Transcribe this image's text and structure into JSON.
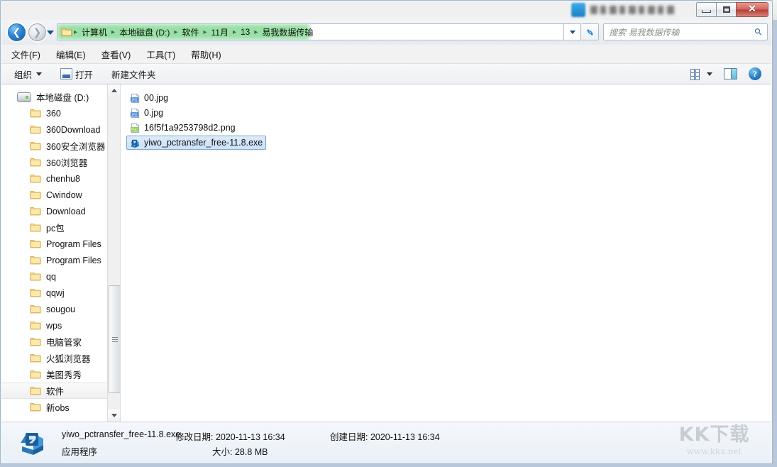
{
  "window": {
    "controls": {
      "minimize": "—",
      "maximize": "□",
      "close": "✕"
    }
  },
  "address_bar": {
    "back_label": "◀",
    "forward_label": "▶",
    "folder_icon": "folder-icon",
    "breadcrumbs": [
      "计算机",
      "本地磁盘 (D:)",
      "软件",
      "11月",
      "13",
      "易我数据传输"
    ],
    "separator": "▸",
    "dropdown_label": "▼",
    "refresh_label": "↻"
  },
  "search": {
    "placeholder": "搜索 易我数据传输",
    "icon": "search-icon"
  },
  "menu": {
    "items": [
      {
        "text": "文件(F)",
        "label": "文件",
        "key": "F"
      },
      {
        "text": "编辑(E)",
        "label": "编辑",
        "key": "E"
      },
      {
        "text": "查看(V)",
        "label": "查看",
        "key": "V"
      },
      {
        "text": "工具(T)",
        "label": "工具",
        "key": "T"
      },
      {
        "text": "帮助(H)",
        "label": "帮助",
        "key": "H"
      }
    ]
  },
  "toolbar": {
    "organize_label": "组织",
    "open_label": "打开",
    "new_folder_label": "新建文件夹",
    "view_icon": "view-options-icon",
    "view_caret": "▼",
    "preview_pane_icon": "preview-pane-icon",
    "help_icon": "help-icon",
    "help_glyph": "?"
  },
  "sidebar": {
    "root": {
      "label": "本地磁盘 (D:)",
      "icon": "drive-icon"
    },
    "items": [
      {
        "label": "360",
        "icon": "folder-icon",
        "selected": false
      },
      {
        "label": "360Download",
        "icon": "folder-icon",
        "selected": false
      },
      {
        "label": "360安全浏览器",
        "icon": "folder-icon",
        "selected": false
      },
      {
        "label": "360浏览器",
        "icon": "folder-icon",
        "selected": false
      },
      {
        "label": "chenhu8",
        "icon": "folder-icon",
        "selected": false
      },
      {
        "label": "Cwindow",
        "icon": "folder-icon",
        "selected": false
      },
      {
        "label": "Download",
        "icon": "folder-icon",
        "selected": false
      },
      {
        "label": "pc包",
        "icon": "folder-icon",
        "selected": false
      },
      {
        "label": "Program Files",
        "icon": "folder-icon",
        "selected": false
      },
      {
        "label": "Program Files",
        "icon": "folder-icon",
        "selected": false
      },
      {
        "label": "qq",
        "icon": "folder-icon",
        "selected": false
      },
      {
        "label": "qqwj",
        "icon": "folder-icon",
        "selected": false
      },
      {
        "label": "sougou",
        "icon": "folder-icon",
        "selected": false
      },
      {
        "label": "wps",
        "icon": "folder-icon",
        "selected": false
      },
      {
        "label": "电脑管家",
        "icon": "folder-icon",
        "selected": false
      },
      {
        "label": "火狐浏览器",
        "icon": "folder-icon",
        "selected": false
      },
      {
        "label": "美图秀秀",
        "icon": "folder-icon",
        "selected": false
      },
      {
        "label": "软件",
        "icon": "folder-icon",
        "selected": true
      },
      {
        "label": "新obs",
        "icon": "folder-icon",
        "selected": false
      }
    ],
    "scrollbar": {
      "up_arrow": "▲",
      "down_arrow": "▼"
    }
  },
  "files": [
    {
      "name": "00.jpg",
      "icon": "jpg-file-icon",
      "selected": false
    },
    {
      "name": "0.jpg",
      "icon": "jpg-file-icon",
      "selected": false
    },
    {
      "name": "16f5f1a9253798d2.png",
      "icon": "png-file-icon",
      "selected": false
    },
    {
      "name": "yiwo_pctransfer_free-11.8.exe",
      "icon": "exe-file-icon",
      "selected": true
    }
  ],
  "status": {
    "file_name": "yiwo_pctransfer_free-11.8.exe",
    "file_type": "应用程序",
    "modified": "修改日期: 2020-11-13 16:34",
    "size": "大小: 28.8 MB",
    "created": "创建日期: 2020-11-13 16:34",
    "icon": "application-icon"
  },
  "watermark": {
    "text": "KK下载",
    "url": "www.kkx.net"
  },
  "colors": {
    "accent": "#2a86d8",
    "selection": "#cbe2f7",
    "selection_border": "#7da2ce",
    "highlight_green": "#44c65a",
    "close_button": "#b93c34"
  }
}
